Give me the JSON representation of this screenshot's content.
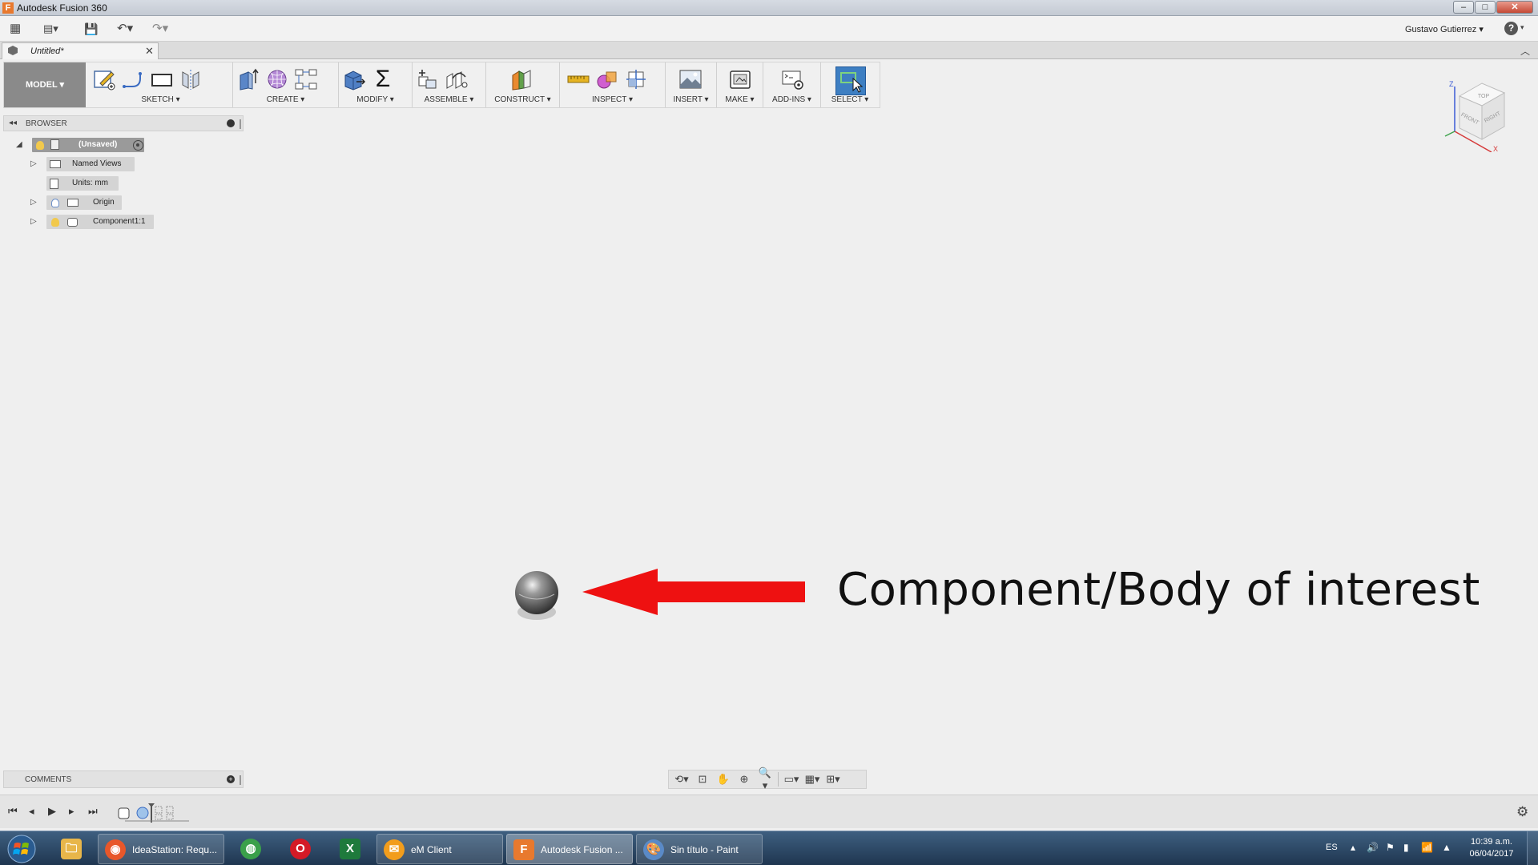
{
  "window": {
    "title": "Autodesk Fusion 360",
    "logo_letter": "F",
    "minimize_glyph": "–",
    "maximize_glyph": "□",
    "close_glyph": "✕"
  },
  "quick_access": {
    "grid_icon": "▦",
    "file_icon": "▤▾",
    "save_icon": "💾",
    "undo_icon": "↶▾",
    "redo_icon": "↷▾",
    "user_name": "Gustavo Gutierrez ▾",
    "help_label": "?",
    "help_caret": "▾"
  },
  "document_tab": {
    "label": "Untitled*",
    "close_glyph": "✕",
    "collapse_glyph": "︿"
  },
  "toolbar": {
    "workspace": "MODEL ▾",
    "groups": [
      {
        "label": "SKETCH ▾",
        "icons": [
          "sketch-create-icon",
          "line-icon",
          "rectangle-icon",
          "mirror-icon"
        ]
      },
      {
        "label": "CREATE ▾",
        "icons": [
          "extrude-icon",
          "form-icon",
          "pattern-icon"
        ]
      },
      {
        "label": "MODIFY ▾",
        "icons": [
          "press-pull-icon",
          "parameters-icon"
        ]
      },
      {
        "label": "ASSEMBLE ▾",
        "icons": [
          "new-component-icon",
          "joint-icon"
        ]
      },
      {
        "label": "CONSTRUCT ▾",
        "icons": [
          "plane-icon"
        ]
      },
      {
        "label": "INSPECT ▾",
        "icons": [
          "measure-icon",
          "interference-icon",
          "section-icon"
        ]
      },
      {
        "label": "INSERT ▾",
        "icons": [
          "insert-image-icon"
        ]
      },
      {
        "label": "MAKE ▾",
        "icons": [
          "print-3d-icon"
        ]
      },
      {
        "label": "ADD-INS ▾",
        "icons": [
          "scripts-icon"
        ]
      },
      {
        "label": "SELECT ▾",
        "icons": [
          "select-icon"
        ]
      }
    ]
  },
  "browser": {
    "collapse_glyph": "◂◂",
    "title": "BROWSER",
    "root": "(Unsaved)",
    "items": [
      {
        "label": "Named Views"
      },
      {
        "label": "Units: mm"
      },
      {
        "label": "Origin"
      },
      {
        "label": "Component1:1"
      }
    ]
  },
  "viewcube": {
    "top": "TOP",
    "front": "FRONT",
    "right": "RIGHT",
    "axis_z": "Z",
    "axis_x": "X",
    "colors": {
      "z": "#3b5bd6",
      "x": "#d63b3b",
      "cube": "#f4f4f4"
    }
  },
  "canvas": {
    "annotation": "Component/Body of interest",
    "arrow_color": "#ee1111"
  },
  "comments": {
    "title": "COMMENTS",
    "add_glyph": "+"
  },
  "navbar": {
    "icons": [
      "orbit-icon",
      "look-at-icon",
      "pan-icon",
      "zoom-icon",
      "fit-icon",
      "display-settings-icon",
      "grid-settings-icon",
      "viewports-icon"
    ],
    "glyphs": [
      "⟲▾",
      "⊡",
      "✋",
      "⊕",
      "🔍▾",
      "▭▾",
      "▦▾",
      "⊞▾"
    ]
  },
  "timeline": {
    "glyphs": [
      "⏮",
      "◂",
      "▶",
      "▸",
      "⏭"
    ],
    "settings_glyph": "⚙"
  },
  "taskbar": {
    "apps": [
      {
        "label": "",
        "glyph": "🗀",
        "color": "#e8b64a"
      },
      {
        "label": "IdeaStation: Requ...",
        "glyph": "◉",
        "color": "#e8572a"
      },
      {
        "label": "",
        "glyph": "◍",
        "color": "#3aa04a"
      },
      {
        "label": "",
        "glyph": "O",
        "color": "#d41a26"
      },
      {
        "label": "",
        "glyph": "X",
        "color": "#1e7a3c"
      },
      {
        "label": "eM Client",
        "glyph": "✉",
        "color": "#f29d1c"
      },
      {
        "label": "Autodesk Fusion ...",
        "glyph": "F",
        "color": "#e8792e"
      },
      {
        "label": "Sin título - Paint",
        "glyph": "🎨",
        "color": "#5a8ac7"
      }
    ],
    "language": "ES",
    "tray_glyphs": [
      "▴",
      "🔊",
      "⚑",
      "▮",
      "📶",
      "▲"
    ],
    "time": "10:39 a.m.",
    "date": "06/04/2017"
  }
}
